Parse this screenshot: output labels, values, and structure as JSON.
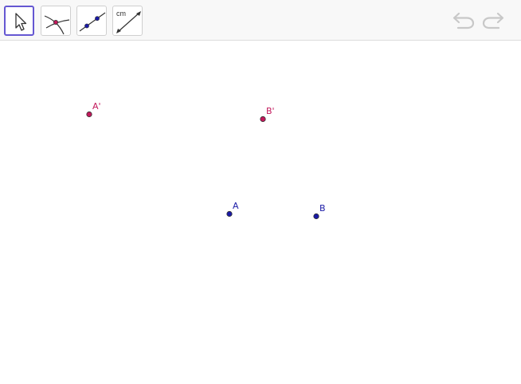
{
  "toolbar": {
    "tools": [
      {
        "name": "move-tool",
        "icon": "cursor-arrow-icon",
        "selected": true
      },
      {
        "name": "intersect-tool",
        "icon": "intersect-curves-icon",
        "selected": false
      },
      {
        "name": "line-tool",
        "icon": "line-through-points-icon",
        "selected": false
      },
      {
        "name": "segment-length-tool",
        "icon": "segment-length-icon",
        "label": "cm",
        "selected": false
      }
    ],
    "undo_icon": "undo-icon",
    "redo_icon": "redo-icon"
  },
  "points": [
    {
      "label": "A'",
      "color": "#c2185b"
    },
    {
      "label": "B'",
      "color": "#c2185b"
    },
    {
      "label": "A",
      "color": "#1a1aa6"
    },
    {
      "label": "B",
      "color": "#1a1aa6"
    }
  ],
  "colors": {
    "toolbar_bg": "#f8f8f8",
    "selected_border": "#6557d2",
    "image_point": "#c2185b",
    "original_point": "#1a1aa6",
    "disabled_icon": "#c8c8c8"
  }
}
